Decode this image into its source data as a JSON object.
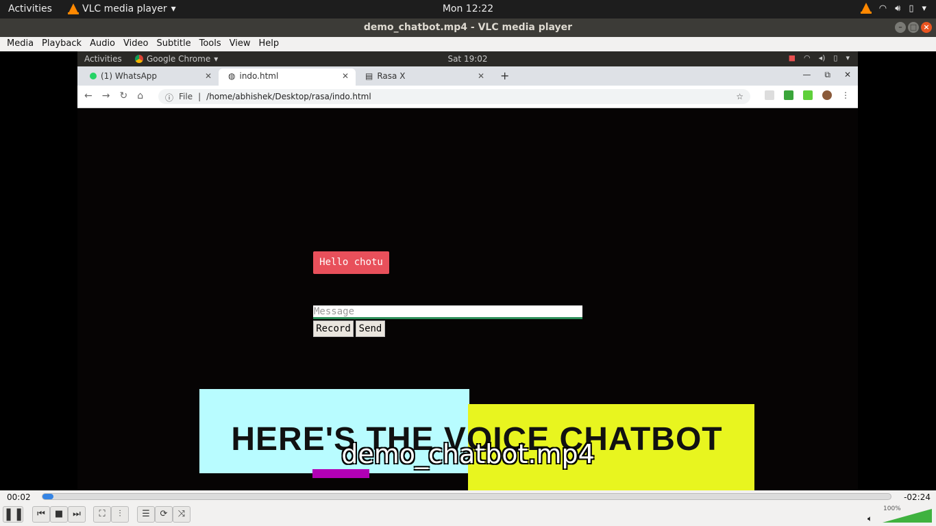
{
  "desktop": {
    "activities": "Activities",
    "app_name": "VLC media player",
    "clock": "Mon 12:22"
  },
  "window": {
    "title": "demo_chatbot.mp4 - VLC media player"
  },
  "menu": [
    "Media",
    "Playback",
    "Audio",
    "Video",
    "Subtitle",
    "Tools",
    "View",
    "Help"
  ],
  "video_frame": {
    "inner_bar": {
      "activities": "Activities",
      "app": "Google Chrome",
      "clock": "Sat 19:02"
    },
    "tabs": [
      {
        "label": "(1) WhatsApp"
      },
      {
        "label": "indo.html"
      },
      {
        "label": "Rasa X"
      }
    ],
    "address": {
      "scheme": "File",
      "path": "/home/abhishek/Desktop/rasa/indo.html"
    },
    "page": {
      "bot_message": "Hello chotu",
      "input_placeholder": "Message",
      "record_label": "Record",
      "send_label": "Send"
    },
    "banner_text": "HERE'S THE VOICE CHATBOT"
  },
  "osd_filename": "demo_chatbot.mp4",
  "player": {
    "current_time": "00:02",
    "remaining_time": "-02:24",
    "progress_fraction": 0.013,
    "volume": "100%"
  },
  "colors": {
    "accent": "#3584e4",
    "bot_bubble": "#e8505b",
    "volume_fill": "#3fb23f",
    "vlc_close": "#e95420"
  }
}
